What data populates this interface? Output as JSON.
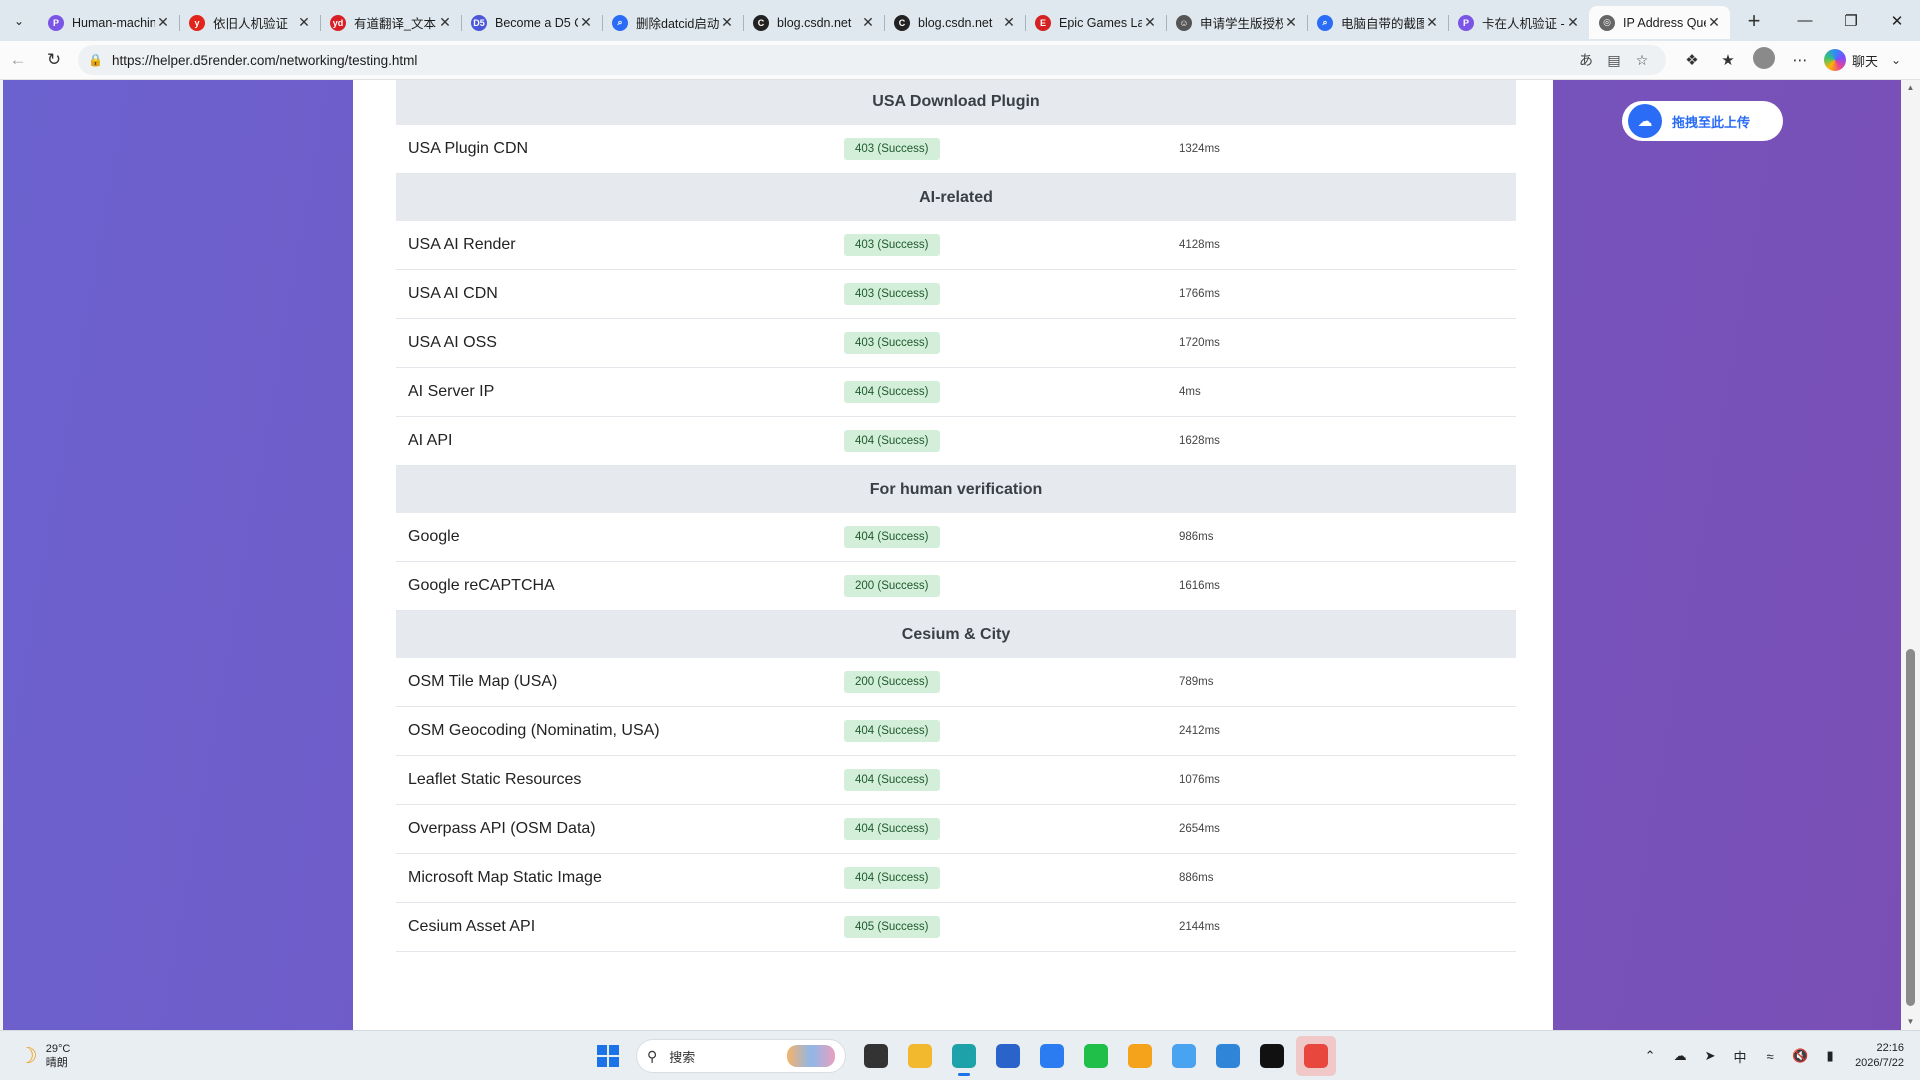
{
  "browser": {
    "tabs": [
      {
        "title": "Human-machin",
        "favicon": "p-purple",
        "color": "#7b55e6",
        "glyph": "P"
      },
      {
        "title": "依旧人机验证",
        "favicon": "y-red",
        "color": "#e1251b",
        "glyph": "y"
      },
      {
        "title": "有道翻译_文本",
        "favicon": "yd-red",
        "color": "#d81f26",
        "glyph": "yd"
      },
      {
        "title": "Become a D5 C",
        "favicon": "d5-blue",
        "color": "#4b57d8",
        "glyph": "D5"
      },
      {
        "title": "删除datcid启动",
        "favicon": "search",
        "color": "#2a6cf6",
        "glyph": "⌕"
      },
      {
        "title": "blog.csdn.net",
        "favicon": "csdn",
        "color": "#222222",
        "glyph": "C"
      },
      {
        "title": "blog.csdn.net",
        "favicon": "csdn",
        "color": "#222222",
        "glyph": "C"
      },
      {
        "title": "Epic Games Lau",
        "favicon": "epic",
        "color": "#d42121",
        "glyph": "E"
      },
      {
        "title": "申请学生版授权",
        "favicon": "person",
        "color": "#555555",
        "glyph": "☺"
      },
      {
        "title": "电脑自带的截图",
        "favicon": "search",
        "color": "#2a6cf6",
        "glyph": "⌕"
      },
      {
        "title": "卡在人机验证 -",
        "favicon": "p-purple",
        "color": "#7b55e6",
        "glyph": "P"
      },
      {
        "title": "IP Address Que",
        "favicon": "globe",
        "color": "#666666",
        "glyph": "◎",
        "active": true
      }
    ],
    "new_tab": "+",
    "url": "https://helper.d5render.com/networking/testing.html",
    "copilot_label": "聊天"
  },
  "upload_button": {
    "label": "拖拽至此上传"
  },
  "sections": [
    {
      "title": "USA Download Plugin",
      "rows": [
        {
          "name": "USA Plugin CDN",
          "status": "403 (Success)",
          "time": "1324ms"
        }
      ]
    },
    {
      "title": "AI-related",
      "rows": [
        {
          "name": "USA AI Render",
          "status": "403 (Success)",
          "time": "4128ms"
        },
        {
          "name": "USA AI CDN",
          "status": "403 (Success)",
          "time": "1766ms"
        },
        {
          "name": "USA AI OSS",
          "status": "403 (Success)",
          "time": "1720ms"
        },
        {
          "name": "AI Server IP",
          "status": "404 (Success)",
          "time": "4ms"
        },
        {
          "name": "AI API",
          "status": "404 (Success)",
          "time": "1628ms"
        }
      ]
    },
    {
      "title": "For human verification",
      "rows": [
        {
          "name": "Google",
          "status": "404 (Success)",
          "time": "986ms"
        },
        {
          "name": "Google reCAPTCHA",
          "status": "200 (Success)",
          "time": "1616ms"
        }
      ]
    },
    {
      "title": "Cesium & City",
      "rows": [
        {
          "name": "OSM Tile Map (USA)",
          "status": "200 (Success)",
          "time": "789ms"
        },
        {
          "name": "OSM Geocoding (Nominatim, USA)",
          "status": "404 (Success)",
          "time": "2412ms"
        },
        {
          "name": "Leaflet Static Resources",
          "status": "404 (Success)",
          "time": "1076ms"
        },
        {
          "name": "Overpass API (OSM Data)",
          "status": "404 (Success)",
          "time": "2654ms"
        },
        {
          "name": "Microsoft Map Static Image",
          "status": "404 (Success)",
          "time": "886ms"
        },
        {
          "name": "Cesium Asset API",
          "status": "405 (Success)",
          "time": "2144ms"
        }
      ]
    }
  ],
  "taskbar": {
    "weather_temp": "29°C",
    "weather_desc": "晴朗",
    "search_placeholder": "搜索",
    "ime": "中",
    "time": "22:16",
    "date": "2026/7/22",
    "apps": [
      {
        "name": "file-explorer-app",
        "color": "#333333"
      },
      {
        "name": "folder-app",
        "color": "#f2b82e"
      },
      {
        "name": "edge-app",
        "color": "#1ca2a8",
        "active": true
      },
      {
        "name": "store-app",
        "color": "#2a63c9"
      },
      {
        "name": "todo-app",
        "color": "#2a7cf0"
      },
      {
        "name": "wechat-app",
        "color": "#1fbf4a"
      },
      {
        "name": "pen-app",
        "color": "#f4a31a"
      },
      {
        "name": "feedback-app",
        "color": "#4aa3f0"
      },
      {
        "name": "remote-app",
        "color": "#2f86d9"
      },
      {
        "name": "terminal-app",
        "color": "#111111"
      },
      {
        "name": "snipping-app",
        "color": "#e7473c",
        "hot": true
      }
    ]
  }
}
